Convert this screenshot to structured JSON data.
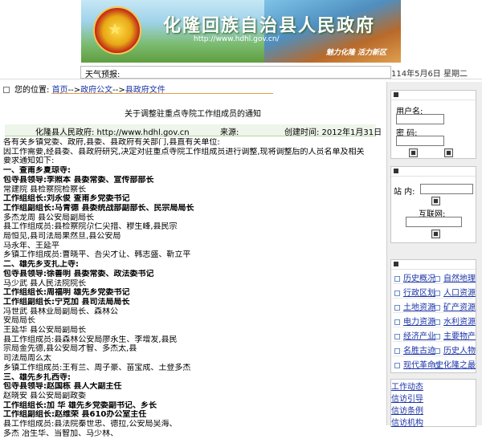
{
  "banner": {
    "title": "化隆回族自治县人民政府",
    "url": "http://www.hdhl.gov.cn/",
    "slogan": "魅力化隆  活力新区"
  },
  "weather_label": "天气预报:",
  "date": "114年5月6日  星期二",
  "breadcrumb": {
    "prefix": "您的位置:",
    "home": "首页",
    "sep1": "-->",
    "l1": "政府公文",
    "sep2": "-->",
    "l2": "县政府文件"
  },
  "article": {
    "title": "关于调整驻重点寺院工作组成员的通知",
    "publisher": "化隆县人民政府: http://www.hdhl.gov.cn",
    "source_label": "来源:",
    "created": "创建时间: 2012年1月31日",
    "lines": [
      {
        "t": "各有关乡镇党委、政府,县委、县政府有关部门,县直有关单位:",
        "b": false
      },
      {
        "t": "因工作需要,经县委、县政府研究,决定对驻重点寺院工作组成员进行调整,现将调整后的人员名单及相关",
        "b": false
      },
      {
        "t": "要求通知如下:",
        "b": false
      },
      {
        "t": "一、查甫乡夏琼寺:",
        "b": true
      },
      {
        "t": "包寺县领导:李照本      县委常委、宣传部部长",
        "b": true
      },
      {
        "t": "常建院      县检察院检察长",
        "b": false
      },
      {
        "t": "工作组组长:刘永俊      查甫乡党委书记",
        "b": true
      },
      {
        "t": "工作组副组长:马青德   县委统战部副部长、民宗局局长",
        "b": true
      },
      {
        "t": "                       多杰龙周     县公安局副局长",
        "b": false
      },
      {
        "t": "县工作组成员:县检察院尕仁尖措、穆生峰,县民宗",
        "b": false
      },
      {
        "t": "局恒见,县司法局果然旦,县公安局",
        "b": false
      },
      {
        "t": "马永年、王延平",
        "b": false
      },
      {
        "t": "乡镇工作组成员:曹晓平、吾尖才让、韩志盛、靳立平",
        "b": false
      },
      {
        "t": "二、雄先乡支扎上寺:",
        "b": true
      },
      {
        "t": "包寺县领导:徐善明      县委常委、政法委书记",
        "b": true
      },
      {
        "t": "                  马少武     县人民法院院长",
        "b": false
      },
      {
        "t": "工作组组长:周福明      雄先乡党委书记",
        "b": true
      },
      {
        "t": "工作组副组长:宁克加      县司法局局长",
        "b": true
      },
      {
        "t": "冯世武    县林业局副局长、森林公",
        "b": false
      },
      {
        "t": "安局局长",
        "b": false
      },
      {
        "t": "                        王延华     县公安局副局长",
        "b": false
      },
      {
        "t": "县工作组成员:县森林公安局廖永生、李增发,县民",
        "b": false
      },
      {
        "t": "宗局金先德,县公安局才智、多杰太,县",
        "b": false
      },
      {
        "t": "司法局周么太",
        "b": false
      },
      {
        "t": "乡镇工作组成员:王有兰、周子豪、苗宝成、土登多杰",
        "b": false
      },
      {
        "t": "三、雄先乡扎西寺:",
        "b": true
      },
      {
        "t": "包寺县领导:赵国栋      县人大副主任",
        "b": true
      },
      {
        "t": "赵晓安      县公安局副政委",
        "b": false
      },
      {
        "t": "工作组组长:加 华      雄先乡党委副书记、乡长",
        "b": true
      },
      {
        "t": "工作组副组长:赵维荣    县610办公室主任",
        "b": true
      },
      {
        "t": "县工作组成员:县法院秦世忠、德拉,公安局吴海、",
        "b": false
      },
      {
        "t": "多杰                  冶生华、当智加、马少林、",
        "b": false
      }
    ]
  },
  "login": {
    "username_label": "用户名:",
    "password_label": "密    码:"
  },
  "search": {
    "site_label": "站  内:",
    "web_label": "互联网:"
  },
  "nav": {
    "col1": [
      "历史概况",
      "行政区划",
      "土地资源",
      "电力资源",
      "经济产业",
      "名胜古迹",
      "现代革命史"
    ],
    "col2": [
      "自然地理",
      "人口资源",
      "矿产资源",
      "水利资源",
      "主要物产",
      "历史人物",
      "化隆之最"
    ]
  },
  "nav2": {
    "col1": [
      "工作动态",
      "信访引导"
    ],
    "col2": [
      "信访条例",
      "信访机构"
    ]
  }
}
